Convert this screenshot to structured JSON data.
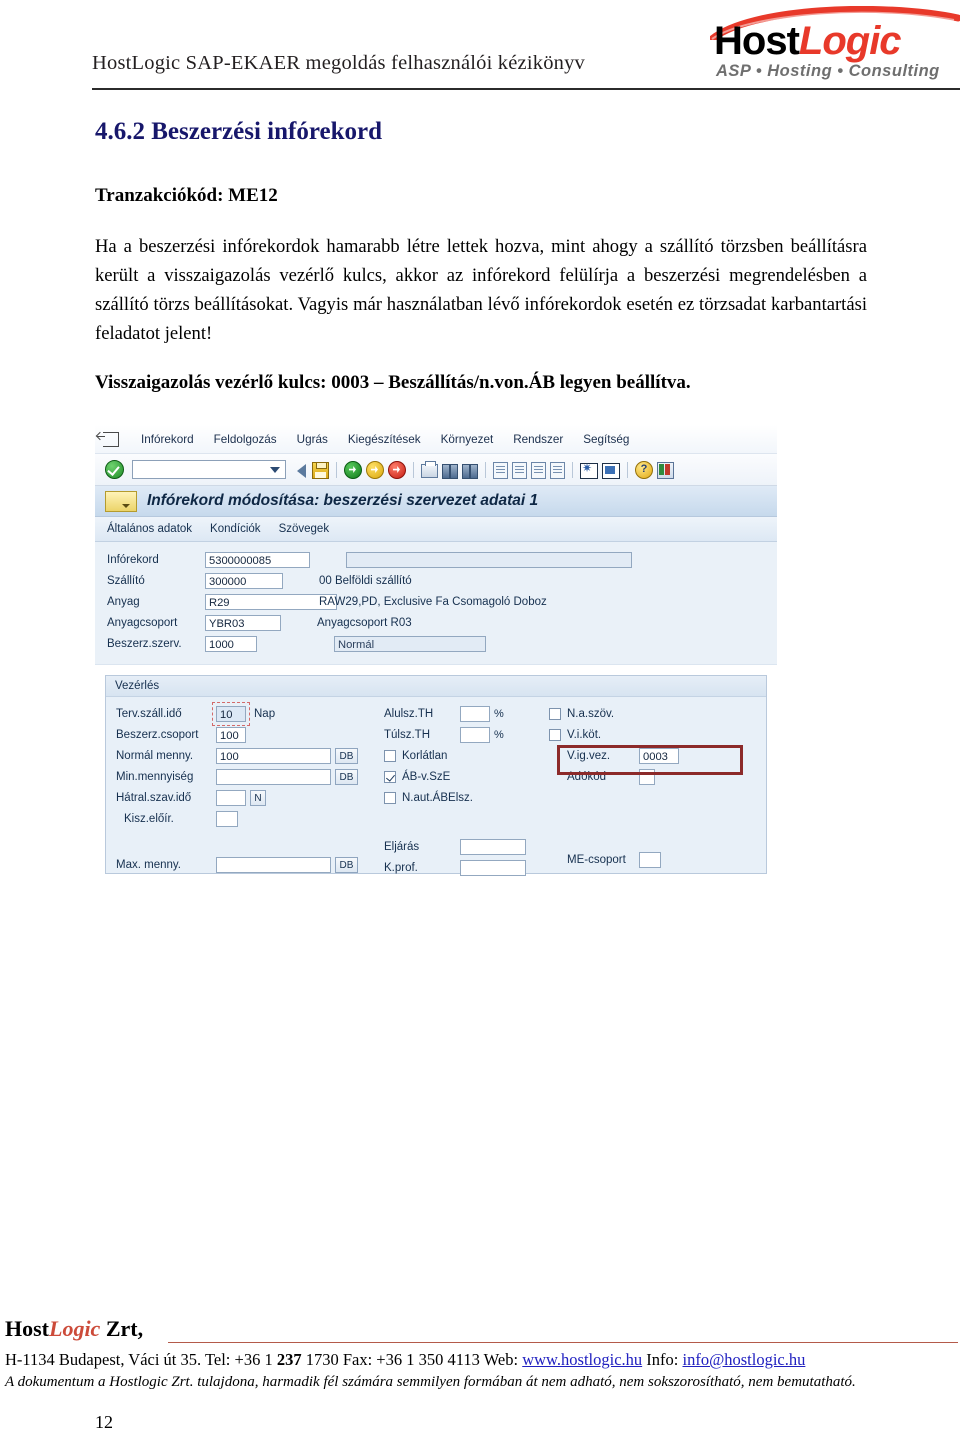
{
  "header": {
    "document_title": "HostLogic SAP-EKAER megoldás felhasználói kézikönyv",
    "logo": {
      "part1": "Host",
      "part2": "Logic",
      "tagline": "ASP  •  Hosting  •  Consulting"
    }
  },
  "content": {
    "heading": "4.6.2 Beszerzési infórekord",
    "subheading": "Tranzakciókód: ME12",
    "paragraph": "Ha a beszerzési infórekordok hamarabb létre lettek hozva, mint ahogy a szállító törzsben beállításra került a visszaigazolás vezérlő kulcs, akkor az infórekord felülírja a beszerzési megrendelésben a szállító törzs beállításokat. Vagyis már használatban lévő infórekordok esetén ez törzsadat karbantartási feladatot jelent!",
    "bold_note": "Visszaigazolás vezérlő kulcs: 0003 – Beszállítás/n.von.ÁB legyen beállítva."
  },
  "sap": {
    "menu": [
      "Infórekord",
      "Feldolgozás",
      "Ugrás",
      "Kiegészítések",
      "Környezet",
      "Rendszer",
      "Segítség"
    ],
    "command_field_value": "",
    "toolbar_icons": [
      "enter-ok-icon",
      "command-dropdown-icon",
      "back-icon",
      "save-icon",
      "exit-icon",
      "cancel-icon",
      "stop-icon",
      "print-icon",
      "find-icon",
      "find-next-icon",
      "first-page-icon",
      "previous-page-icon",
      "next-page-icon",
      "last-page-icon",
      "new-session-icon",
      "create-shortcut-icon",
      "help-icon",
      "layout-menu-icon"
    ],
    "title": "Infórekord módosítása: beszerzési szervezet adatai 1",
    "tabs": [
      "Általános adatok",
      "Kondíciók",
      "Szövegek"
    ],
    "fields": {
      "inforecord_label": "Infórekord",
      "inforecord_value": "5300000085",
      "inforecord_desc": "",
      "vendor_label": "Szállító",
      "vendor_value": "300000",
      "vendor_desc": "00 Belföldi szállító",
      "material_label": "Anyag",
      "material_value": "R29",
      "material_desc": "RAW29,PD, Exclusive Fa Csomagoló Doboz",
      "matgroup_label": "Anyagcsoport",
      "matgroup_value": "YBR03",
      "matgroup_desc": "Anyagcsoport  R03",
      "purchorg_label": "Beszerz.szerv.",
      "purchorg_value": "1000",
      "purchorg_desc": "Normál"
    },
    "control": {
      "group_title": "Vezérlés",
      "plan_delivery_label": "Terv.száll.idő",
      "plan_delivery_value": "10",
      "plan_delivery_unit": "Nap",
      "purch_group_label": "Beszerz.csoport",
      "purch_group_value": "100",
      "standard_qty_label": "Normál menny.",
      "standard_qty_value": "100",
      "standard_qty_unit": "DB",
      "min_qty_label": "Min.mennyiség",
      "min_qty_value": "",
      "min_qty_unit": "DB",
      "remaining_shelf_label": "Hátral.szav.idő",
      "remaining_shelf_value": "",
      "remaining_shelf_unit": "N",
      "delivery_rule_label": "Kisz.előír.",
      "delivery_rule_value": "",
      "max_qty_label": "Max. menny.",
      "max_qty_value": "",
      "max_qty_unit": "DB",
      "under_tol_label": "Alulsz.TH",
      "under_tol_value": "",
      "under_tol_unit": "%",
      "over_tol_label": "Túlsz.TH",
      "over_tol_value": "",
      "over_tol_unit": "%",
      "unlimited_label": "Korlátlan",
      "unlimited_checked": false,
      "gr_based_iv_label": "ÁB-v.SzE",
      "gr_based_iv_checked": true,
      "no_ers_label": "N.aut.ÁBElsz.",
      "no_ers_checked": false,
      "procedure_label": "Eljárás",
      "procedure_value": "",
      "qa_profile_label": "K.prof.",
      "qa_profile_value": "",
      "no_mat_text_label": "N.a.szöv.",
      "no_mat_text_checked": false,
      "ack_req_label": "V.i.köt.",
      "ack_req_checked": false,
      "conf_control_label": "V.ig.vez.",
      "conf_control_value": "0003",
      "tax_code_label": "Adókód",
      "tax_code_value": "",
      "me_group_label": "ME-csoport",
      "me_group_value": ""
    }
  },
  "footer": {
    "brand_host": "Host",
    "brand_logic": "Logic",
    "brand_suffix": " Zrt,",
    "address_prefix": "H-1134 Budapest, Váci út 35. Tel: +36 1 ",
    "phone_bold": "237",
    "address_middle": " 1730 Fax: +36 1 350 4113 Web: ",
    "web_link": "www.hostlogic.hu",
    "info_label": " Info: ",
    "email_link": "info@hostlogic.hu",
    "disclaimer": "A dokumentum a Hostlogic Zrt. tulajdona, harmadik fél számára semmilyen formában át nem adható, nem sokszorosítható, nem bemutatható.",
    "page_number": "12"
  }
}
